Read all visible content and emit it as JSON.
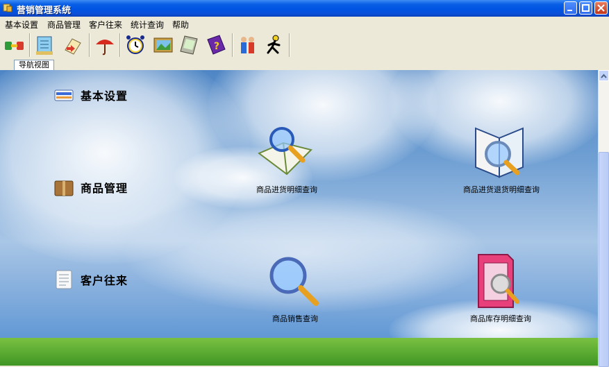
{
  "window": {
    "title": "营销管理系统"
  },
  "menu": [
    "基本设置",
    "商品管理",
    "客户往来",
    "统计查询",
    "帮助"
  ],
  "toolbar": {
    "buttons": [
      "plug-icon",
      "notepad-icon",
      "folder-transfer-icon",
      "umbrella-icon",
      "alarm-clock-icon",
      "picture-icon",
      "pda-icon",
      "help-book-icon",
      "users-icon",
      "running-man-icon"
    ]
  },
  "tab": {
    "label": "导航视图"
  },
  "nav": [
    {
      "label": "基本设置",
      "icon": "settings-panel-icon"
    },
    {
      "label": "商品管理",
      "icon": "package-icon"
    },
    {
      "label": "客户往来",
      "icon": "document-icon"
    }
  ],
  "features": [
    {
      "label": "商品进货明细查询",
      "icon": "book-magnifier-icon"
    },
    {
      "label": "商品进货退货明细查询",
      "icon": "open-book-magnifier-icon"
    },
    {
      "label": "商品销售查询",
      "icon": "magnifier-icon"
    },
    {
      "label": "商品库存明细查询",
      "icon": "folder-magnifier-icon"
    }
  ],
  "colors": {
    "titlebar": "#0054e3",
    "sky": "#6f9fd3",
    "grass": "#5aa832"
  }
}
